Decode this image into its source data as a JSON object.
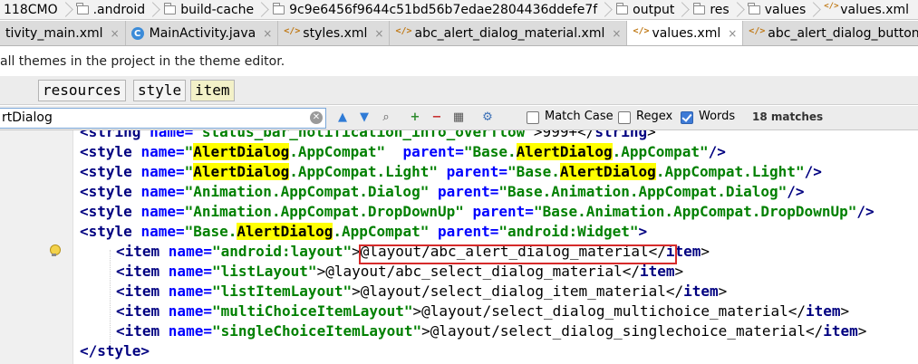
{
  "breadcrumb": [
    {
      "label": "118CMO",
      "icon": "folder-icon"
    },
    {
      "label": ".android",
      "icon": "folder-icon"
    },
    {
      "label": "build-cache",
      "icon": "folder-icon"
    },
    {
      "label": "9c9e6456f9644c51bd56b7edae2804436ddefe7f",
      "icon": "folder-icon"
    },
    {
      "label": "output",
      "icon": "folder-icon"
    },
    {
      "label": "res",
      "icon": "folder-icon"
    },
    {
      "label": "values",
      "icon": "folder-icon"
    },
    {
      "label": "values.xml",
      "icon": "xml-file-icon"
    }
  ],
  "tabs": [
    {
      "label": "tivity_main.xml",
      "icon": "xml-file-icon",
      "active": false
    },
    {
      "label": "MainActivity.java",
      "icon": "java-class-icon",
      "active": false
    },
    {
      "label": "styles.xml",
      "icon": "xml-file-icon",
      "active": false
    },
    {
      "label": "abc_alert_dialog_material.xml",
      "icon": "xml-file-icon",
      "active": false
    },
    {
      "label": "values.xml",
      "icon": "xml-file-icon",
      "active": true
    },
    {
      "label": "abc_alert_dialog_button_bar_mate",
      "icon": "xml-file-icon",
      "active": false
    }
  ],
  "banner": {
    "text": "all themes in the project in the theme editor."
  },
  "tag_path": [
    "resources",
    "style",
    "item"
  ],
  "search": {
    "value": "rtDialog",
    "match_case_label": "Match Case",
    "regex_label": "Regex",
    "words_label": "Words",
    "match_case": false,
    "regex": false,
    "words": true,
    "matches": "18 matches"
  },
  "code_lines": [
    {
      "indent": 1,
      "tokens": [
        {
          "t": "tag",
          "s": "<string "
        },
        {
          "t": "attr",
          "s": "name="
        },
        {
          "t": "val",
          "s": "\"status_bar_notification_info_overflow\""
        },
        {
          "t": "plain",
          "s": ">999+</"
        },
        {
          "t": "tag",
          "s": "string"
        },
        {
          "t": "plain",
          "s": ">"
        }
      ]
    },
    {
      "indent": 1,
      "tokens": [
        {
          "t": "tag",
          "s": "<style "
        },
        {
          "t": "attr",
          "s": "name="
        },
        {
          "t": "val",
          "s": "\""
        },
        {
          "t": "hl",
          "s": "AlertDialog"
        },
        {
          "t": "val",
          "s": ".AppCompat\" "
        },
        {
          "t": "attr",
          "s": " parent="
        },
        {
          "t": "val",
          "s": "\"Base."
        },
        {
          "t": "hl",
          "s": "AlertDialog"
        },
        {
          "t": "val",
          "s": ".AppCompat\""
        },
        {
          "t": "tag",
          "s": "/>"
        }
      ]
    },
    {
      "indent": 1,
      "tokens": [
        {
          "t": "tag",
          "s": "<style "
        },
        {
          "t": "attr",
          "s": "name="
        },
        {
          "t": "val",
          "s": "\""
        },
        {
          "t": "hl",
          "s": "AlertDialog"
        },
        {
          "t": "val",
          "s": ".AppCompat.Light\" "
        },
        {
          "t": "attr",
          "s": "parent="
        },
        {
          "t": "val",
          "s": "\"Base."
        },
        {
          "t": "hl",
          "s": "AlertDialog"
        },
        {
          "t": "val",
          "s": ".AppCompat.Light\""
        },
        {
          "t": "tag",
          "s": "/>"
        }
      ]
    },
    {
      "indent": 1,
      "tokens": [
        {
          "t": "tag",
          "s": "<style "
        },
        {
          "t": "attr",
          "s": "name="
        },
        {
          "t": "val",
          "s": "\"Animation.AppCompat.Dialog\" "
        },
        {
          "t": "attr",
          "s": "parent="
        },
        {
          "t": "val",
          "s": "\"Base.Animation.AppCompat.Dialog\""
        },
        {
          "t": "tag",
          "s": "/>"
        }
      ]
    },
    {
      "indent": 1,
      "tokens": [
        {
          "t": "tag",
          "s": "<style "
        },
        {
          "t": "attr",
          "s": "name="
        },
        {
          "t": "val",
          "s": "\"Animation.AppCompat.DropDownUp\" "
        },
        {
          "t": "attr",
          "s": "parent="
        },
        {
          "t": "val",
          "s": "\"Base.Animation.AppCompat.DropDownUp\""
        },
        {
          "t": "tag",
          "s": "/>"
        }
      ]
    },
    {
      "indent": 1,
      "tokens": [
        {
          "t": "tag",
          "s": "<style "
        },
        {
          "t": "attr",
          "s": "name="
        },
        {
          "t": "val",
          "s": "\"Base."
        },
        {
          "t": "hl",
          "s": "AlertDialog"
        },
        {
          "t": "val",
          "s": ".AppCompat\" "
        },
        {
          "t": "attr",
          "s": "parent="
        },
        {
          "t": "val",
          "s": "\"android:Widget\""
        },
        {
          "t": "tag",
          "s": ">"
        }
      ]
    },
    {
      "indent": 2,
      "tokens": [
        {
          "t": "tag",
          "s": "<item "
        },
        {
          "t": "attr",
          "s": "name="
        },
        {
          "t": "val",
          "s": "\"android:layout\""
        },
        {
          "t": "plain",
          "s": ">@layout/abc_alert_dialog_material</"
        },
        {
          "t": "tag",
          "s": "item"
        },
        {
          "t": "plain",
          "s": ">"
        }
      ]
    },
    {
      "indent": 2,
      "tokens": [
        {
          "t": "tag",
          "s": "<item "
        },
        {
          "t": "attr",
          "s": "name="
        },
        {
          "t": "val",
          "s": "\"listLayout\""
        },
        {
          "t": "plain",
          "s": ">@layout/abc_select_dialog_material</"
        },
        {
          "t": "tag",
          "s": "item"
        },
        {
          "t": "plain",
          "s": ">"
        }
      ]
    },
    {
      "indent": 2,
      "tokens": [
        {
          "t": "tag",
          "s": "<item "
        },
        {
          "t": "attr",
          "s": "name="
        },
        {
          "t": "val",
          "s": "\"listItemLayout\""
        },
        {
          "t": "plain",
          "s": ">@layout/select_dialog_item_material</"
        },
        {
          "t": "tag",
          "s": "item"
        },
        {
          "t": "plain",
          "s": ">"
        }
      ]
    },
    {
      "indent": 2,
      "tokens": [
        {
          "t": "tag",
          "s": "<item "
        },
        {
          "t": "attr",
          "s": "name="
        },
        {
          "t": "val",
          "s": "\"multiChoiceItemLayout\""
        },
        {
          "t": "plain",
          "s": ">@layout/select_dialog_multichoice_material</"
        },
        {
          "t": "tag",
          "s": "item"
        },
        {
          "t": "plain",
          "s": ">"
        }
      ]
    },
    {
      "indent": 2,
      "tokens": [
        {
          "t": "tag",
          "s": "<item "
        },
        {
          "t": "attr",
          "s": "name="
        },
        {
          "t": "val",
          "s": "\"singleChoiceItemLayout\""
        },
        {
          "t": "plain",
          "s": ">@layout/select_dialog_singlechoice_material</"
        },
        {
          "t": "tag",
          "s": "item"
        },
        {
          "t": "plain",
          "s": ">"
        }
      ]
    },
    {
      "indent": 1,
      "tokens": [
        {
          "t": "tag",
          "s": "</style>"
        }
      ]
    }
  ],
  "colors": {
    "tag": "#000080",
    "attr": "#0000ff",
    "value": "#008000",
    "highlight": "#ffff00",
    "callout_box": "#d62a2a"
  }
}
